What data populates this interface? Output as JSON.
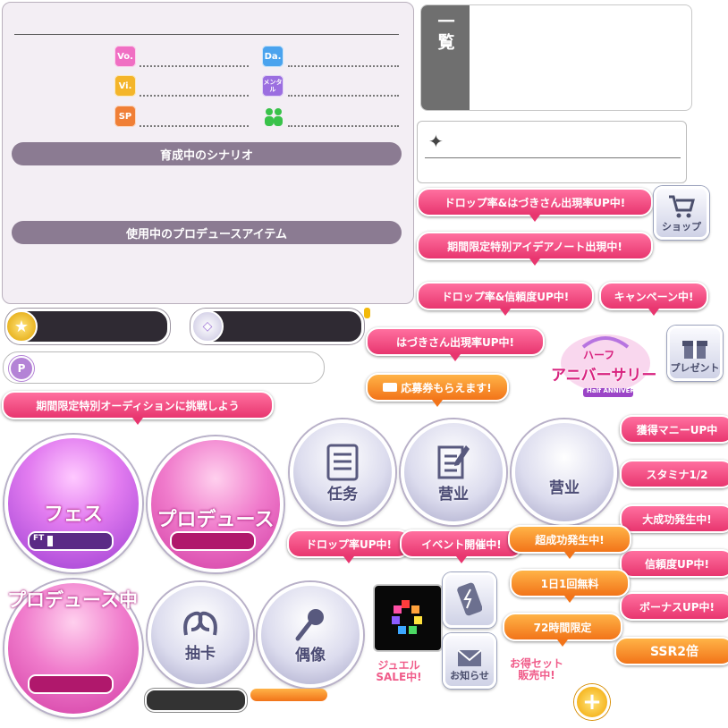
{
  "status_panel": {
    "stats": [
      {
        "badge": "Vo.",
        "color": "#f06fc3"
      },
      {
        "badge": "Da.",
        "color": "#4aa3ee"
      },
      {
        "badge": "Vi.",
        "color": "#f4b52a"
      },
      {
        "badge": "メンタル",
        "color": "#9b6ee0"
      },
      {
        "badge": "SP",
        "color": "#f07f36"
      },
      {
        "badge": "",
        "color": "#39c24a"
      }
    ],
    "scenario_label": "育成中のシナリオ",
    "item_label": "使用中のプロデュースアイテム"
  },
  "list_panel": {
    "tab_label": "一覧"
  },
  "info_panel": {
    "icon": "sparkle-icon"
  },
  "tags": {
    "drop_hazuki": "ドロップ率&はづきさん出現率UP中!",
    "idea_note": "期間限定特別アイデアノート出現中!",
    "drop_trust": "ドロップ率&信頼度UP中!",
    "campaign": "キャンペーン中!",
    "hazuki_rate": "はづきさん出現率UP中!",
    "ticket": "応募券もらえます!",
    "audition": "期間限定特別オーディションに挑戦しよう",
    "money_up": "獲得マニーUP中",
    "stamina": "スタミナ1/2",
    "great_success": "大成功発生中!",
    "trust_up": "信頼度UP中!",
    "bonus_up": "ボーナスUP中!",
    "ssr2": "SSR2倍",
    "drop_up": "ドロップ率UP中!",
    "event": "イベント開催中!",
    "super_success": "超成功発生中!",
    "daily_free": "1日1回無料",
    "limited72": "72時間限定"
  },
  "buttons": {
    "shop": "ショップ",
    "present": "プレゼント",
    "mission": "任务",
    "business1": "营业",
    "business2": "营业",
    "fes": "フェス",
    "fes_gauge": "FT",
    "produce": "プロデュース",
    "producing": "プロデュース中",
    "gacha": "抽卡",
    "idol": "偶像",
    "news": "お知らせ",
    "jewel_sale": "ジュエル SALE中!",
    "bargain_set": "お得セット 販売中!"
  },
  "logo": {
    "line1": "ハーフ",
    "line2": "アニバーサリー",
    "line3": "Half ANNIVERSARY"
  }
}
